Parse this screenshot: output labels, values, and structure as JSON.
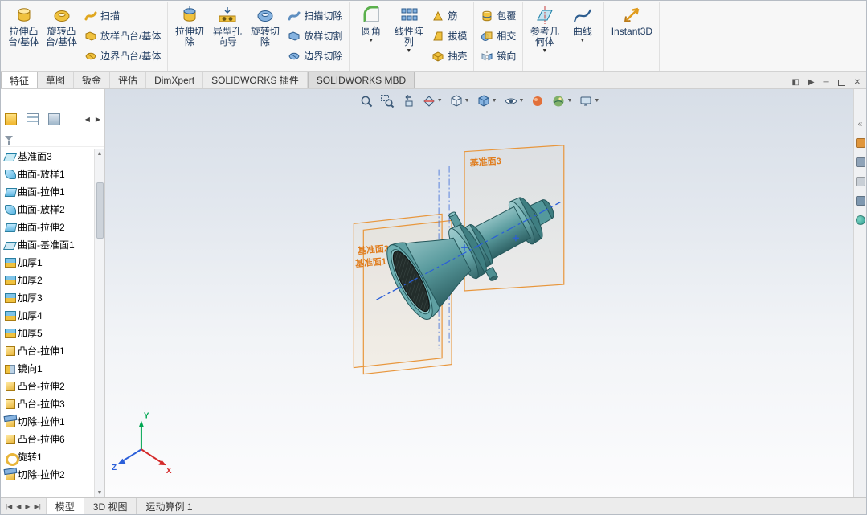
{
  "window": {
    "controls": {
      "pane": "◧",
      "expand": "▶",
      "minimize": "─",
      "close": "✕"
    }
  },
  "ribbon": {
    "groups": [
      {
        "big": [
          "拉伸凸\n台/基体",
          "旋转凸\n台/基体"
        ],
        "small": [
          "扫描",
          "放样凸台/基体",
          "边界凸台/基体"
        ]
      },
      {
        "big": [
          "拉伸切\n除",
          "异型孔\n向导",
          "旋转切\n除"
        ],
        "small": [
          "扫描切除",
          "放样切割",
          "边界切除"
        ]
      },
      {
        "big": [
          "圆角",
          "线性阵\n列"
        ],
        "small": [
          "筋",
          "拔模",
          "抽壳"
        ]
      },
      {
        "big": [],
        "small": [
          "包覆",
          "相交",
          "镜向"
        ]
      },
      {
        "big": [
          "参考几\n何体",
          "曲线"
        ],
        "small": []
      },
      {
        "big": [
          "Instant3D"
        ],
        "small": []
      }
    ]
  },
  "tabs": [
    "特征",
    "草图",
    "钣金",
    "评估",
    "DimXpert",
    "SOLIDWORKS 插件",
    "SOLIDWORKS MBD"
  ],
  "fm": {
    "prev": "◀",
    "next": "▶",
    "scroll_up": "▲",
    "scroll_down": "▼"
  },
  "tree": {
    "items": [
      {
        "label": "基准面3"
      },
      {
        "label": "曲面-放样1"
      },
      {
        "label": "曲面-拉伸1"
      },
      {
        "label": "曲面-放样2"
      },
      {
        "label": "曲面-拉伸2"
      },
      {
        "label": "曲面-基准面1"
      },
      {
        "label": "加厚1"
      },
      {
        "label": "加厚2"
      },
      {
        "label": "加厚3"
      },
      {
        "label": "加厚4"
      },
      {
        "label": "加厚5"
      },
      {
        "label": "凸台-拉伸1"
      },
      {
        "label": "镜向1"
      },
      {
        "label": "凸台-拉伸2"
      },
      {
        "label": "凸台-拉伸3"
      },
      {
        "label": "切除-拉伸1"
      },
      {
        "label": "凸台-拉伸6"
      },
      {
        "label": "旋转1"
      },
      {
        "label": "切除-拉伸2"
      }
    ]
  },
  "viewport": {
    "planes": {
      "left_front": "基准面2",
      "left_back": "基准面1",
      "right": "基准面3"
    },
    "triad": {
      "x": "X",
      "y": "Y",
      "z": "Z"
    },
    "hud_icons": [
      "zoom-fit",
      "zoom-area",
      "previous-view",
      "section-view",
      "view-orientation",
      "display-style",
      "hide-show-items",
      "edit-appearance",
      "apply-scene",
      "view-settings"
    ],
    "colors": {
      "model": "#4f9093",
      "plane": "#e8963c",
      "centerline": "#2b5fd9"
    }
  },
  "taskpane": {
    "chevron": "«",
    "icons": [
      "resources",
      "design-library",
      "file-explorer",
      "view-palette",
      "appearances"
    ]
  },
  "bottom": {
    "nav": [
      "|◀",
      "◀",
      "▶",
      "▶|"
    ],
    "tabs": [
      "模型",
      "3D 视图",
      "运动算例 1"
    ]
  },
  "icons": {
    "caret": "▼"
  }
}
